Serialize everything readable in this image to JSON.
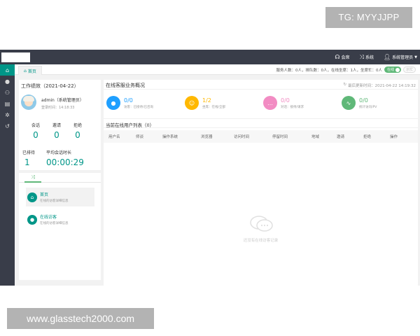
{
  "watermarks": {
    "top": "TG: MYYJJPP",
    "bottom": "www.glasstech2000.com"
  },
  "topnav": {
    "sessions": "会席",
    "system": "系统",
    "admin": "系统管理员"
  },
  "tabbar": {
    "home_tab": "首页",
    "status": "服务人数：0人，排队数：0人，在线坐席：1人，坐席忙：0人",
    "online_label": "在线",
    "busy_label": "示忙"
  },
  "perf": {
    "title": "工作绩效（2021-04-22）",
    "user_name": "admin（系统管理员）",
    "login_time": "登录时间：14:18:33",
    "stats": [
      {
        "label": "会话",
        "value": "0"
      },
      {
        "label": "邀请",
        "value": "0"
      },
      {
        "label": "拒绝",
        "value": "0"
      }
    ],
    "queued_label": "已排待",
    "queued_value": "1",
    "avg_label": "平均会话时长",
    "avg_value": "00:00:29"
  },
  "guide": {
    "items": [
      {
        "title": "首页",
        "desc": "在线的访客详细信息"
      },
      {
        "title": "在线访客",
        "desc": "在线的访客详细信息"
      }
    ]
  },
  "overview": {
    "title": "在线客服业务概况",
    "update_time": "最后更新时间：2021-04-22 14:19:32",
    "metrics": [
      {
        "value": "0/0",
        "sub": "访客：已接待/已咨询",
        "color": "#1e9fff",
        "icon": "user-icon"
      },
      {
        "value": "1/2",
        "sub": "坐席：在线/全部",
        "color": "#ffb800",
        "icon": "agent-icon"
      },
      {
        "value": "0/0",
        "sub": "对话：接待/请求",
        "color": "#f28cc3",
        "icon": "chat-icon"
      },
      {
        "value": "0/0",
        "sub": "统计访问/PV",
        "color": "#5fb878",
        "icon": "pulse-icon"
      }
    ]
  },
  "list": {
    "title": "当前在线用户列表（0）",
    "columns": [
      "用户名",
      "师谈",
      "操作系统",
      "浏览器",
      "访问时间",
      "停留时间",
      "地域",
      "邀请",
      "拒绝",
      "操作"
    ],
    "empty_text": "还没有在线访客记录"
  }
}
